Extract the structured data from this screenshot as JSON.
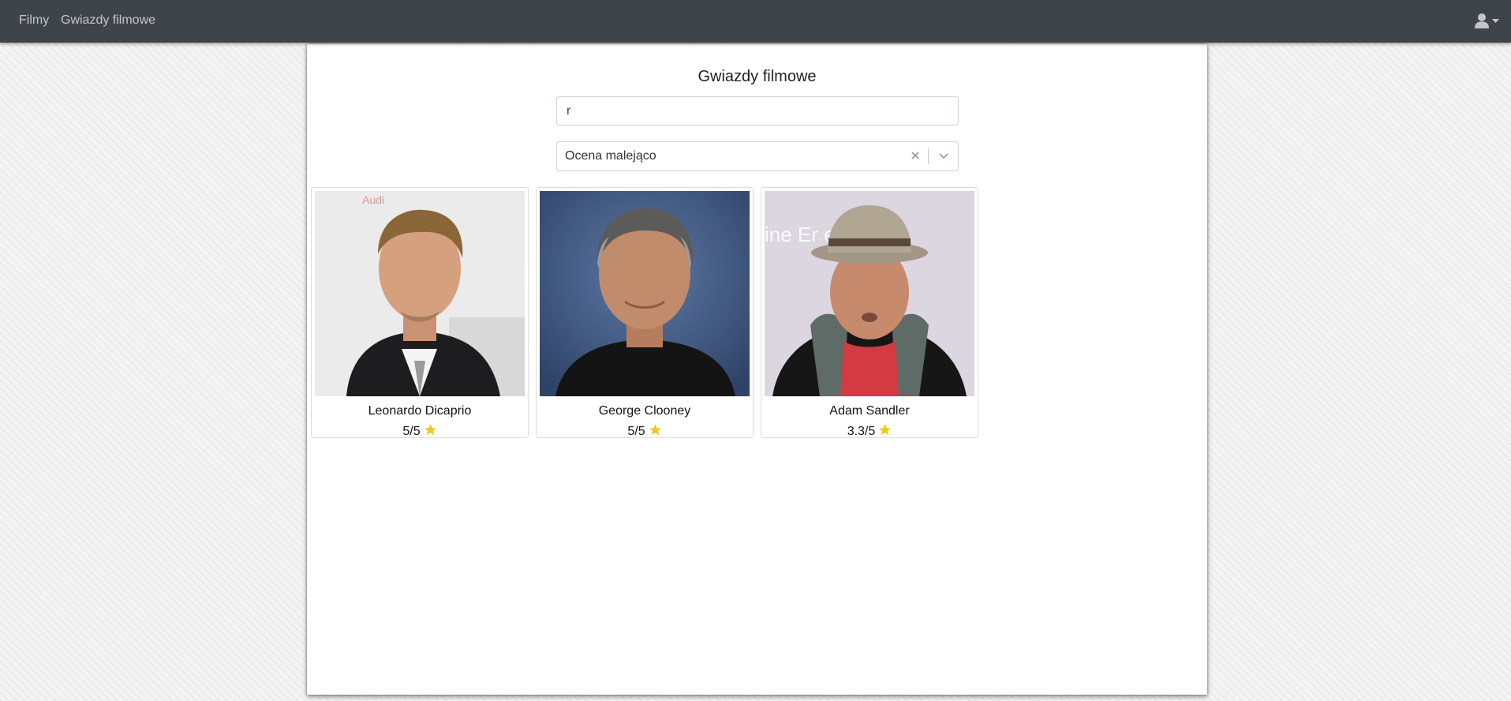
{
  "nav": {
    "links": [
      "Filmy",
      "Gwiazdy filmowe"
    ],
    "user_icon": "user-icon"
  },
  "page": {
    "title": "Gwiazdy filmowe"
  },
  "search": {
    "value": "r"
  },
  "sort": {
    "selected": "Ocena malejąco"
  },
  "stars": [
    {
      "name": "Leonardo Dicaprio",
      "rating": "5/5"
    },
    {
      "name": "George Clooney",
      "rating": "5/5"
    },
    {
      "name": "Adam Sandler",
      "rating": "3.3/5"
    }
  ],
  "colors": {
    "navbar": "#3f444b",
    "nav_text": "#c3c6c9",
    "star": "#f5c518"
  }
}
